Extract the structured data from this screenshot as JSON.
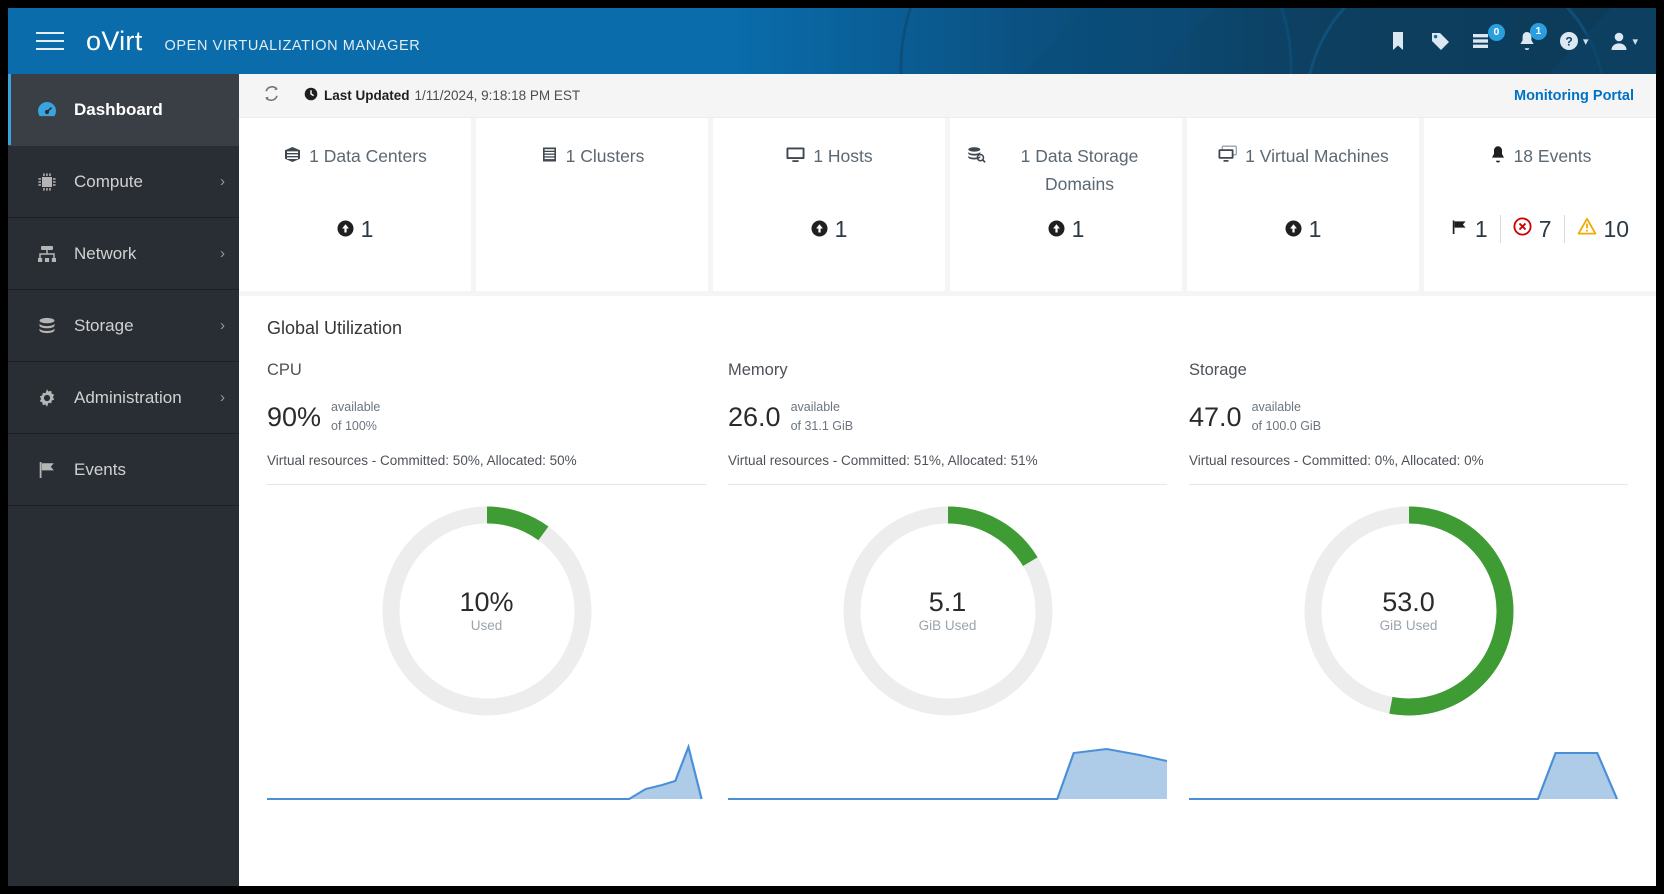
{
  "masthead": {
    "menu_icon": "hamburger-menu-icon",
    "logo_text": "oVirt",
    "product_name": "OPEN VIRTUALIZATION MANAGER",
    "icons": [
      {
        "name": "bookmark-icon",
        "badge": null
      },
      {
        "name": "tag-icon",
        "badge": null
      },
      {
        "name": "tasks-list-icon",
        "badge": "0"
      },
      {
        "name": "notifications-bell-icon",
        "badge": "1"
      },
      {
        "name": "help-icon",
        "badge": null,
        "caret": "▾"
      },
      {
        "name": "user-account-icon",
        "badge": null,
        "caret": "▾"
      }
    ]
  },
  "sidebar": {
    "items": [
      {
        "label": "Dashboard",
        "icon": "dashboard-gauge-icon",
        "active": true,
        "has_submenu": false
      },
      {
        "label": "Compute",
        "icon": "cpu-chip-icon",
        "active": false,
        "has_submenu": true
      },
      {
        "label": "Network",
        "icon": "network-topology-icon",
        "active": false,
        "has_submenu": true
      },
      {
        "label": "Storage",
        "icon": "database-stack-icon",
        "active": false,
        "has_submenu": true
      },
      {
        "label": "Administration",
        "icon": "gear-icon",
        "active": false,
        "has_submenu": true
      },
      {
        "label": "Events",
        "icon": "flag-icon",
        "active": false,
        "has_submenu": false
      }
    ],
    "submenu_arrow": "›"
  },
  "toolbar": {
    "refresh_icon": "refresh-icon",
    "clock_icon": "clock-icon",
    "last_updated_label": "Last Updated",
    "last_updated_time": "1/11/2024, 9:18:18 PM EST",
    "monitoring_portal_label": "Monitoring Portal"
  },
  "cards": [
    {
      "icon": "data-center-icon",
      "title": "1 Data Centers",
      "stats": [
        {
          "icon": "status-up-icon",
          "value": "1",
          "kind": "up"
        }
      ]
    },
    {
      "icon": "cluster-icon",
      "title": "1 Clusters",
      "stats": []
    },
    {
      "icon": "host-monitor-icon",
      "title": "1 Hosts",
      "stats": [
        {
          "icon": "status-up-icon",
          "value": "1",
          "kind": "up"
        }
      ]
    },
    {
      "icon": "storage-domain-icon",
      "title": "1 Data Storage Domains",
      "stats": [
        {
          "icon": "status-up-icon",
          "value": "1",
          "kind": "up"
        }
      ]
    },
    {
      "icon": "virtual-machine-icon",
      "title": "1 Virtual Machines",
      "stats": [
        {
          "icon": "status-up-icon",
          "value": "1",
          "kind": "up"
        }
      ]
    },
    {
      "icon": "bell-icon",
      "title": "18 Events",
      "stats": [
        {
          "icon": "flag-icon",
          "value": "1",
          "kind": "flag"
        },
        {
          "icon": "error-circle-icon",
          "value": "7",
          "kind": "error"
        },
        {
          "icon": "warning-triangle-icon",
          "value": "10",
          "kind": "warning"
        }
      ]
    }
  ],
  "global_utilization": {
    "title": "Global Utilization",
    "available_word": "available",
    "used_word": "Used",
    "columns": [
      {
        "name": "CPU",
        "available_value": "90%",
        "of_text": "of 100%",
        "virtual_resources": "Virtual resources - Committed: 50%, Allocated: 50%",
        "donut_value": "10%",
        "donut_unit": "Used"
      },
      {
        "name": "Memory",
        "available_value": "26.0",
        "of_text": "of 31.1 GiB",
        "virtual_resources": "Virtual resources - Committed: 51%, Allocated: 51%",
        "donut_value": "5.1",
        "donut_unit": "GiB Used"
      },
      {
        "name": "Storage",
        "available_value": "47.0",
        "of_text": "of 100.0 GiB",
        "virtual_resources": "Virtual resources - Committed: 0%, Allocated: 0%",
        "donut_value": "53.0",
        "donut_unit": "GiB Used"
      }
    ]
  },
  "chart_data": [
    {
      "type": "pie",
      "title": "CPU",
      "labels": [
        "Used",
        "Available"
      ],
      "values": [
        10,
        90
      ],
      "unit": "%",
      "center_label": "10%",
      "center_sublabel": "Used",
      "colors": [
        "#3f9c35",
        "#ededed"
      ]
    },
    {
      "type": "pie",
      "title": "Memory",
      "labels": [
        "Used",
        "Available"
      ],
      "values": [
        5.1,
        26.0
      ],
      "unit": "GiB",
      "total": 31.1,
      "center_label": "5.1",
      "center_sublabel": "GiB Used",
      "colors": [
        "#3f9c35",
        "#ededed"
      ]
    },
    {
      "type": "pie",
      "title": "Storage",
      "labels": [
        "Used",
        "Available"
      ],
      "values": [
        53.0,
        47.0
      ],
      "unit": "GiB",
      "total": 100.0,
      "center_label": "53.0",
      "center_sublabel": "GiB Used",
      "colors": [
        "#3f9c35",
        "#ededed"
      ]
    },
    {
      "type": "area",
      "title": "CPU history sparkline",
      "x": [
        0,
        1,
        2,
        3,
        4,
        5,
        6,
        7,
        8,
        9,
        10,
        11,
        12
      ],
      "values": [
        0,
        0,
        0,
        0,
        0,
        0,
        0,
        0,
        0,
        4,
        6,
        7,
        22
      ],
      "ylabel": "%",
      "color": "#7dabdc"
    },
    {
      "type": "area",
      "title": "Memory history sparkline",
      "x": [
        0,
        1,
        2,
        3,
        4,
        5,
        6,
        7,
        8,
        9,
        10,
        11,
        12
      ],
      "values": [
        0,
        0,
        0,
        0,
        0,
        0,
        0,
        0,
        0,
        0,
        18,
        20,
        20
      ],
      "ylabel": "GiB",
      "color": "#7dabdc"
    },
    {
      "type": "area",
      "title": "Storage history sparkline",
      "x": [
        0,
        1,
        2,
        3,
        4,
        5,
        6,
        7,
        8,
        9,
        10,
        11,
        12
      ],
      "values": [
        0,
        0,
        0,
        0,
        0,
        0,
        0,
        0,
        0,
        0,
        0,
        20,
        20
      ],
      "ylabel": "GiB",
      "color": "#7dabdc"
    }
  ]
}
